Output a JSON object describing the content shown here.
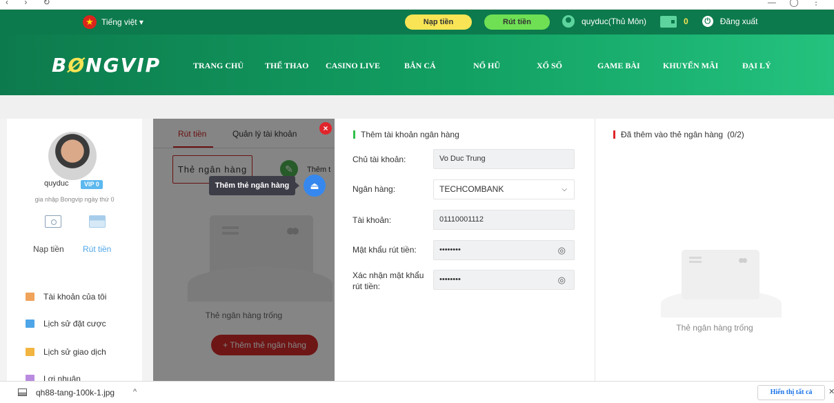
{
  "topbar": {
    "language": "Tiếng việt ▾",
    "deposit_btn": "Nạp tiền",
    "withdraw_btn": "Rút tiền",
    "username": "quyduc(Thủ Môn)",
    "balance": "0",
    "logout": "Đăng xuất"
  },
  "header": {
    "logo_pre": "B",
    "logo_hl": "Ø",
    "logo_post": "NGVIP",
    "menu": [
      "TRANG CHỦ",
      "THỂ THAO",
      "CASINO LIVE",
      "BẮN CÁ",
      "NỔ HŨ",
      "XỔ SỐ",
      "GAME BÀI",
      "KHUYẾN MÃI",
      "ĐẠI LÝ"
    ]
  },
  "sidebar": {
    "username": "quyduc",
    "vip": "VIP 0",
    "join_text": "gia nhập Bongvip ngày thứ 0",
    "deposit": "Nạp tiền",
    "withdraw": "Rút tiền",
    "items": [
      {
        "label": "Tài khoản của tôi",
        "color": "#f0a35a"
      },
      {
        "label": "Lịch sử đặt cược",
        "color": "#4ea6e8"
      },
      {
        "label": "Lịch sử giao dịch",
        "color": "#f2b541"
      },
      {
        "label": "Lợi nhuận",
        "color": "#b98be0"
      }
    ]
  },
  "withdraw_panel": {
    "tab_withdraw": "Rút tiền",
    "tab_manage": "Quản lý tài khoản",
    "card_tab": "Thẻ ngân hàng",
    "add_label": "Thêm t",
    "empty_text": "Thẻ ngân hàng trống",
    "add_card_btn": "+ Thêm thẻ ngân hàng",
    "tooltip": "Thêm thẻ ngân hàng"
  },
  "form": {
    "title": "Thêm tài khoản ngân hàng",
    "accent": "#2fbf4b",
    "owner_label": "Chủ tài khoản:",
    "owner_value": "Vo Duc Trung",
    "bank_label": "Ngân hàng:",
    "bank_value": "TECHCOMBANK",
    "account_label": "Tài khoản:",
    "account_value": "01110001112",
    "pwd_label": "Mật khẩu rút tiền:",
    "pwd_value": "••••••••",
    "confirm_label_1": "Xác nhận mật khẩu",
    "confirm_label_2": "rút tiền:",
    "confirm_value": "••••••••"
  },
  "saved": {
    "title": "Đã thêm vào thẻ ngân hàng",
    "count": "(0/2)",
    "accent": "#e0252b",
    "empty_text": "Thẻ ngân hàng trống"
  },
  "downloads": {
    "file": "qh88-tang-100k-1.jpg",
    "show_all": "Hiển thị tất cả"
  }
}
